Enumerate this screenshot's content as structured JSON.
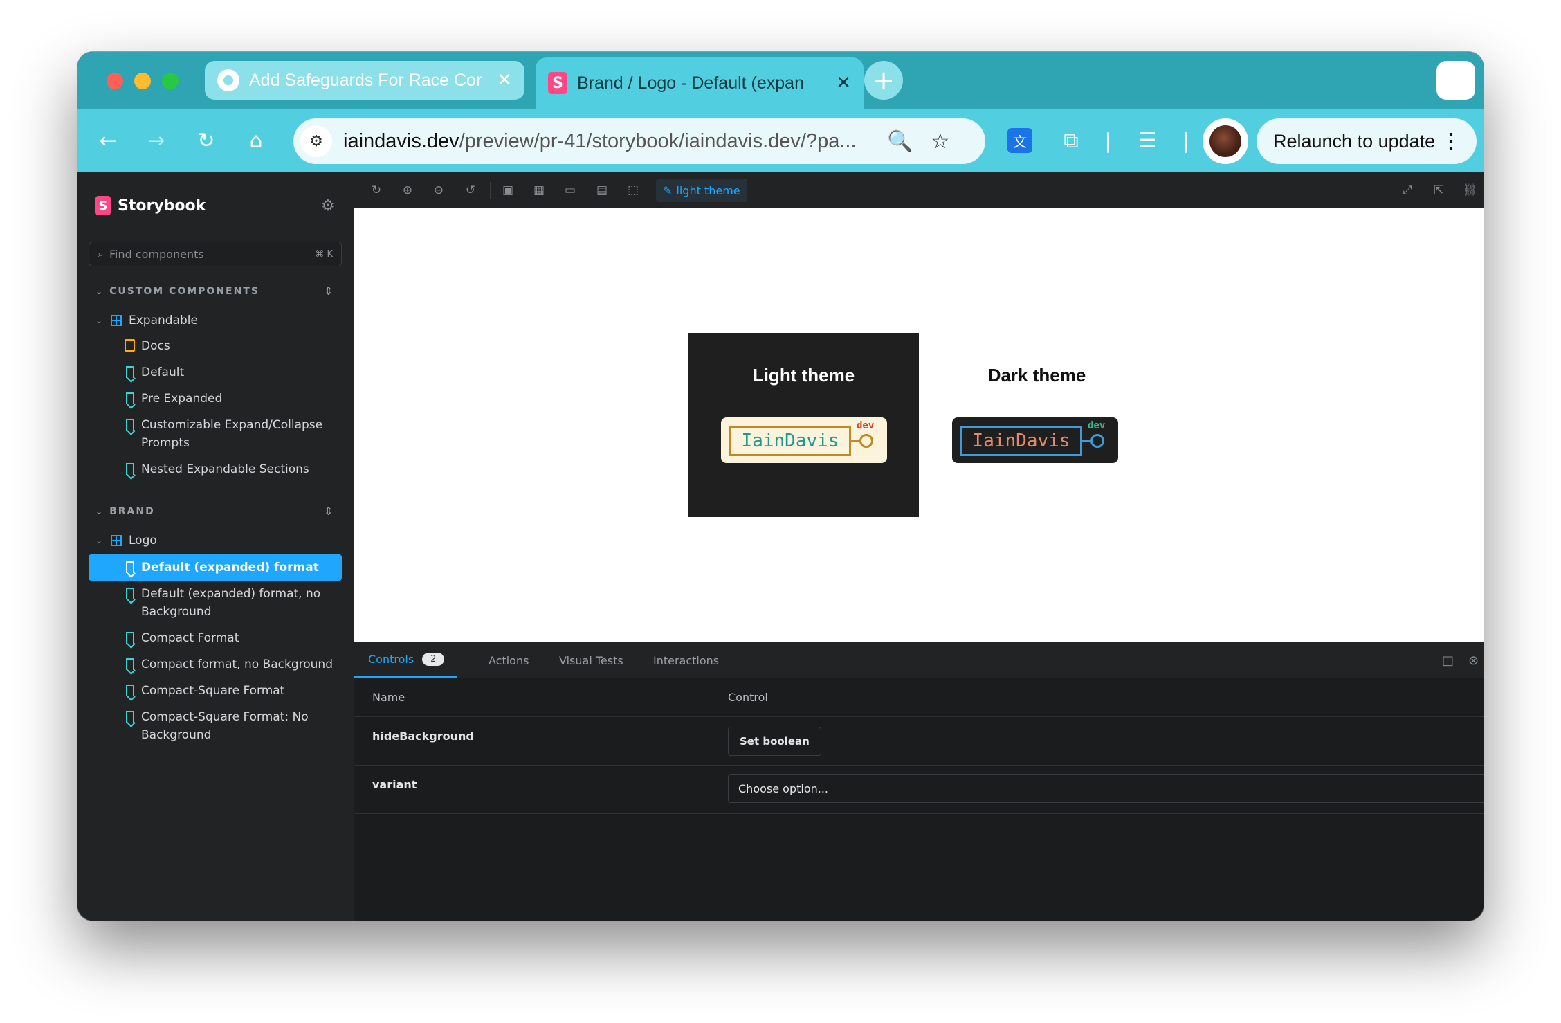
{
  "browser": {
    "tabs": [
      {
        "title": "Add Safeguards For Race Cor",
        "close": "✕"
      },
      {
        "title": "Brand / Logo - Default (expan",
        "close": "✕"
      }
    ],
    "new_tab": "+",
    "url_host": "iaindavis.dev",
    "url_path": "/preview/pr-41/storybook/iaindavis.dev/?pa...",
    "relaunch_label": "Relaunch to update",
    "icons": {
      "back": "←",
      "forward": "→",
      "reload": "↻",
      "home": "⌂",
      "zoom": "🔍",
      "star": "☆",
      "translate": "文",
      "extensions": "⧉",
      "reading_list": "☰",
      "menu": "⋮"
    }
  },
  "storybook": {
    "brand": "Storybook",
    "brand_mark": "S",
    "search_placeholder": "Find components",
    "search_shortcut": "⌘ K",
    "groups": [
      {
        "title": "CUSTOM COMPONENTS",
        "component": "Expandable",
        "stories": [
          "Docs",
          "Default",
          "Pre Expanded",
          "Customizable Expand/Collapse Prompts",
          "Nested Expandable Sections"
        ]
      },
      {
        "title": "BRAND",
        "component": "Logo",
        "stories": [
          "Default (expanded) format",
          "Default (expanded) format, no Background",
          "Compact Format",
          "Compact format, no Background",
          "Compact-Square Format",
          "Compact-Square Format: No Background"
        ]
      }
    ],
    "theme_button": "light theme",
    "preview": {
      "light_title": "Light theme",
      "dark_title": "Dark theme",
      "logo_text": "IainDavis",
      "logo_tag": "dev"
    },
    "panel": {
      "tabs": [
        {
          "label": "Controls",
          "badge": "2"
        },
        {
          "label": "Actions"
        },
        {
          "label": "Visual Tests"
        },
        {
          "label": "Interactions"
        }
      ],
      "columns": {
        "name": "Name",
        "control": "Control"
      },
      "rows": [
        {
          "name": "hideBackground",
          "control": "Set boolean"
        },
        {
          "name": "variant",
          "control": "Choose option..."
        }
      ]
    }
  },
  "colors": {
    "accent": "#1ea7fd",
    "chrome": "#51cfe0",
    "tabstrip": "#2fa5b4",
    "storybook_pink": "#ff4785"
  }
}
